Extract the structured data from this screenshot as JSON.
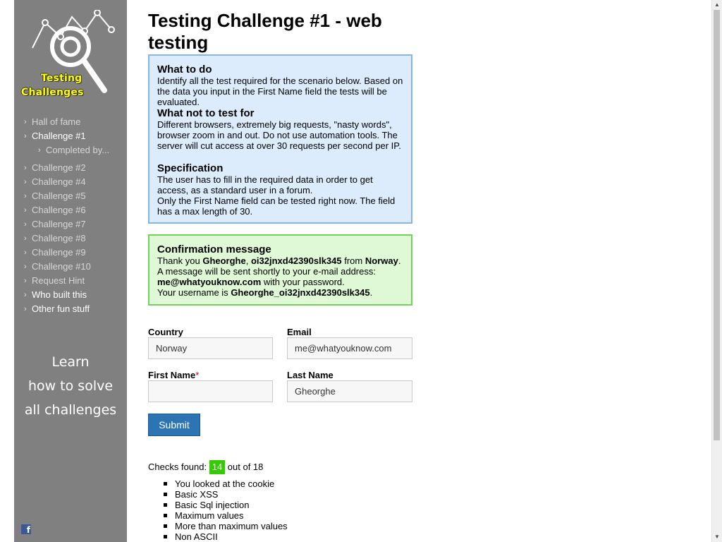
{
  "logo": {
    "line1": "Testing",
    "line2": "Challenges"
  },
  "nav": [
    {
      "label": "Hall of fame"
    },
    {
      "label": "Challenge #1"
    },
    {
      "label": "Completed by..."
    },
    {
      "label": "Challenge #2"
    },
    {
      "label": "Challenge #4"
    },
    {
      "label": "Challenge #5"
    },
    {
      "label": "Challenge #6"
    },
    {
      "label": "Challenge #7"
    },
    {
      "label": "Challenge #8"
    },
    {
      "label": "Challenge #9"
    },
    {
      "label": "Challenge #10"
    },
    {
      "label": "Request Hint"
    },
    {
      "label": "Who built this"
    },
    {
      "label": "Other fun stuff"
    }
  ],
  "learn": {
    "line1": "Learn",
    "line2": "how to solve",
    "line3": "all challenges"
  },
  "page": {
    "title": "Testing Challenge #1 - web testing"
  },
  "info": {
    "what_to_do_title": "What to do",
    "what_to_do_text": "Identify all the test required for the scenario below. Based on the data you input in the First Name field the tests will be evaluated.",
    "not_to_test_title": "What not to test for",
    "not_to_test_text": "Different browsers, extremely big requests, \"nasty words\", browser zoom in and out. Do not use automation tools. The server will cut access at over 30 requests per second per IP.",
    "spec_title": "Specification",
    "spec_text1": "The user has to fill in the required data in order to get access, as a standard user in a forum.",
    "spec_text2": "Only the First Name field can be tested right now. The field has a max length of 30."
  },
  "confirmation": {
    "title": "Confirmation message",
    "thank_you": "Thank you ",
    "last_name": "Gheorghe",
    "comma": ", ",
    "first_name": "oi32jnxd42390slk345",
    "from": " from ",
    "country": "Norway",
    "period": ".",
    "message": "A message will be sent shortly to your e-mail address:",
    "email": "me@whatyouknow.com",
    "with_password": " with your password.",
    "username_label": "Your username is ",
    "username": "Gheorghe_oi32jnxd42390slk345",
    "username_end": "."
  },
  "form": {
    "country_label": "Country",
    "country_value": "Norway",
    "email_label": "Email",
    "email_value": "me@whatyouknow.com",
    "first_name_label": "First Name",
    "required_mark": "*",
    "first_name_value": "",
    "last_name_label": "Last Name",
    "last_name_value": "Gheorghe",
    "submit_label": "Submit"
  },
  "checks": {
    "prefix": "Checks found: ",
    "found": "14",
    "suffix": " out of 18",
    "items": [
      "You looked at the cookie",
      "Basic XSS",
      "Basic Sql injection",
      "Maximum values",
      "More than maximum values",
      "Non ASCII"
    ]
  }
}
